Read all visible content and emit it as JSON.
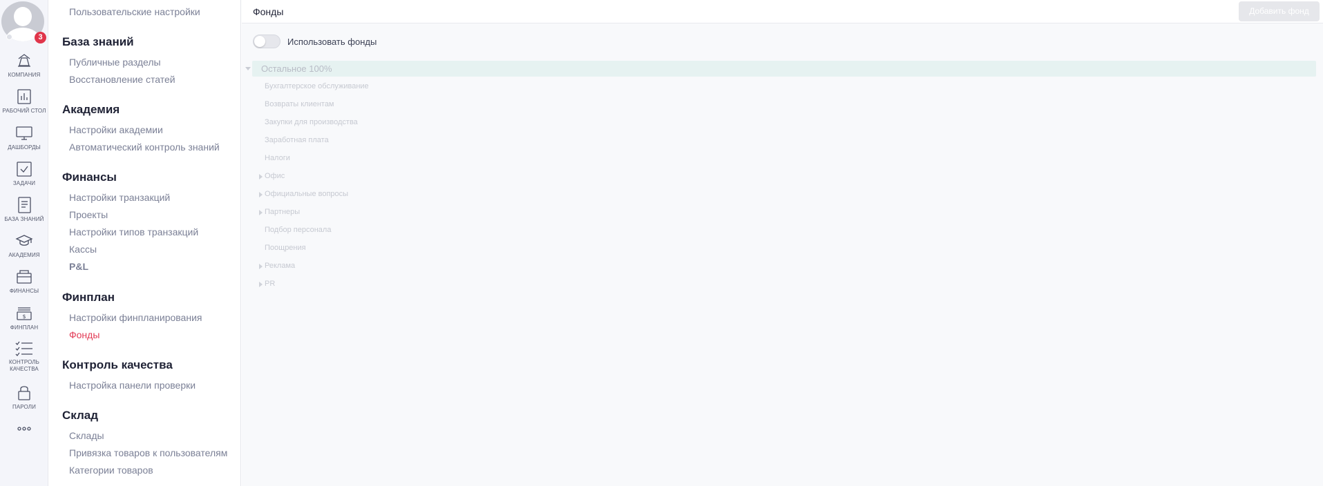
{
  "rail": {
    "notifications_count": "3",
    "items": [
      {
        "label": "КОМПАНИЯ",
        "icon": "company-icon"
      },
      {
        "label": "РАБОЧИЙ СТОЛ",
        "icon": "desktop-icon"
      },
      {
        "label": "ДАШБОРДЫ",
        "icon": "monitor-icon"
      },
      {
        "label": "ЗАДАЧИ",
        "icon": "checkbox-icon"
      },
      {
        "label": "БАЗА ЗНАНИЙ",
        "icon": "document-icon"
      },
      {
        "label": "АКАДЕМИЯ",
        "icon": "graduation-cap-icon"
      },
      {
        "label": "ФИНАНСЫ",
        "icon": "wallet-icon"
      },
      {
        "label": "ФИНПЛАН",
        "icon": "money-stack-icon"
      },
      {
        "label": "КОНТРОЛЬ",
        "label2": "КАЧЕСТВА",
        "icon": "checklist-icon"
      },
      {
        "label": "ПАРОЛИ",
        "icon": "lock-icon"
      }
    ],
    "more_icon": "more-dots-icon"
  },
  "sidebar": {
    "top_link": "Пользовательские настройки",
    "sections": [
      {
        "title": "База знаний",
        "links": [
          "Публичные разделы",
          "Восстановление статей"
        ]
      },
      {
        "title": "Академия",
        "links": [
          "Настройки академии",
          "Автоматический контроль знаний"
        ]
      },
      {
        "title": "Финансы",
        "links": [
          "Настройки транзакций",
          "Проекты",
          "Настройки типов транзакций",
          "Кассы",
          "P&L"
        ]
      },
      {
        "title": "Финплан",
        "links": [
          "Настройки финпланирования",
          "Фонды"
        ]
      },
      {
        "title": "Контроль качества",
        "links": [
          "Настройка панели проверки"
        ]
      },
      {
        "title": "Склад",
        "links": [
          "Склады",
          "Привязка товаров к пользователям",
          "Категории товаров"
        ]
      }
    ],
    "active_link": "Фонды"
  },
  "main": {
    "title": "Фонды",
    "add_button": "Добавить фонд",
    "toggle_label": "Использовать фонды",
    "toggle_on": false,
    "tree_root": "Остальное 100%",
    "tree_items": [
      {
        "label": "Бухгалтерское обслуживание",
        "expandable": false
      },
      {
        "label": "Возвраты клиентам",
        "expandable": false
      },
      {
        "label": "Закупки для производства",
        "expandable": false
      },
      {
        "label": "Заработная плата",
        "expandable": false
      },
      {
        "label": "Налоги",
        "expandable": false
      },
      {
        "label": "Офис",
        "expandable": true
      },
      {
        "label": "Официальные вопросы",
        "expandable": true
      },
      {
        "label": "Партнеры",
        "expandable": true
      },
      {
        "label": "Подбор персонала",
        "expandable": false
      },
      {
        "label": "Поощрения",
        "expandable": false
      },
      {
        "label": "Реклама",
        "expandable": true
      },
      {
        "label": "PR",
        "expandable": true
      }
    ]
  },
  "colors": {
    "accent_active": "#e23a55",
    "badge": "#e0354a",
    "tree_root_bg": "#e6f2f1",
    "rail_bg": "#f4f5fa"
  }
}
